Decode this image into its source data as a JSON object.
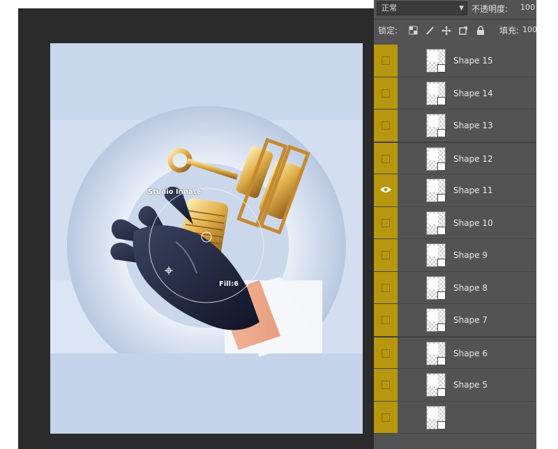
{
  "panel": {
    "blend_mode": "正常",
    "opacity_label": "不透明度:",
    "opacity_value": "100",
    "lock_label": "锁定:",
    "fill_label": "填充:",
    "fill_value": "100",
    "lock_icons": [
      "lock-transparent-pixels-icon",
      "lock-image-pixels-icon",
      "lock-position-icon",
      "lock-artboard-icon",
      "lock-all-icon"
    ]
  },
  "layers": [
    {
      "name": "Shape 15",
      "visible": false
    },
    {
      "name": "Shape 14",
      "visible": false
    },
    {
      "name": "Shape 13",
      "visible": false
    },
    {
      "name": "Shape 12",
      "visible": false
    },
    {
      "name": "Shape 11",
      "visible": true
    },
    {
      "name": "Shape 10",
      "visible": false
    },
    {
      "name": "Shape 9",
      "visible": false
    },
    {
      "name": "Shape 8",
      "visible": false
    },
    {
      "name": "Shape 7",
      "visible": false
    },
    {
      "name": "Shape 6",
      "visible": false
    },
    {
      "name": "Shape 5",
      "visible": false
    },
    {
      "name": "",
      "visible": false
    }
  ],
  "canvas": {
    "cursor_label_top": "Studio Innate",
    "cursor_label_bottom": "Fill:6"
  },
  "colors": {
    "panel_bg": "#535353",
    "eye_column": "#b8960e",
    "canvas_bg": "#2b2b2b",
    "artboard_bg": "#c9d7ec"
  }
}
